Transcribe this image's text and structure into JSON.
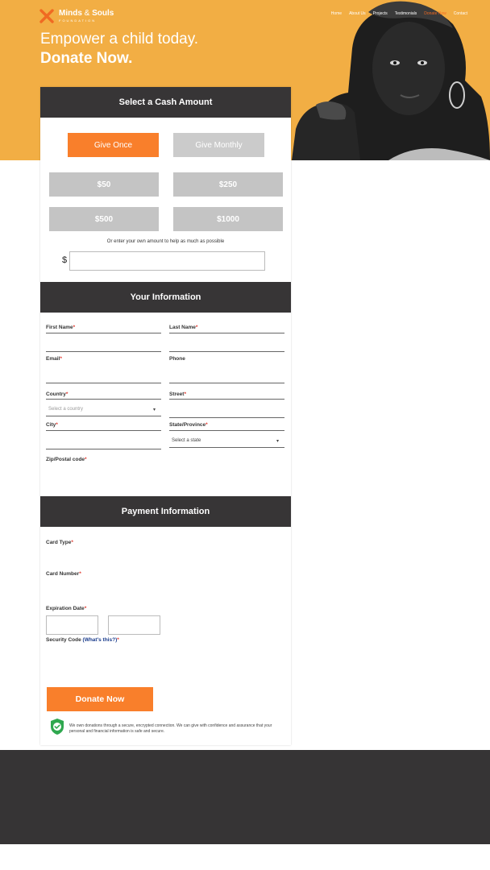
{
  "brand": {
    "name": "Minds",
    "amp": "&",
    "name2": "Souls",
    "subtitle": "FOUNDATION",
    "logo_icon": "x-mark-icon",
    "accent": "#f97f2b"
  },
  "nav": [
    "Home",
    "About Us",
    "Projects",
    "Testimonials",
    "Donate Now",
    "Contact"
  ],
  "hero": {
    "line1": "Empower a child today.",
    "line2": "Donate Now.",
    "background": "#f2ae44"
  },
  "amount_section": {
    "title": "Select a Cash Amount",
    "give_once": "Give Once",
    "give_monthly": "Give Monthly",
    "amounts": [
      "$50",
      "$250",
      "$500",
      "$1000"
    ],
    "own_amount_text": "Or enter your own amount to help as much as possible",
    "currency_symbol": "$",
    "own_amount_value": ""
  },
  "info_section": {
    "title": "Your  Information",
    "first_name": "First Name",
    "last_name": "Last Name",
    "email": "Email",
    "phone": "Phone",
    "country": "Country",
    "country_placeholder": "Select a country",
    "street": "Street",
    "city": "City",
    "state": "State/Province",
    "state_placeholder": "Select a state",
    "zip": "Zip/Postal code",
    "required_mark": "*"
  },
  "payment_section": {
    "title": "Payment  Information",
    "card_type": "Card Type",
    "card_number": "Card Number",
    "expiration": "Expiration Date",
    "security_code": "Security Code",
    "whats_this": "(What's this?)",
    "required_mark": "*"
  },
  "donate_button": "Donate Now",
  "secure_notice": {
    "icon": "shield-check-icon",
    "text": "We own donations through a secure, encrypted connection. We can give with confidence and assurance that your personal and financial information is safe and secure."
  }
}
